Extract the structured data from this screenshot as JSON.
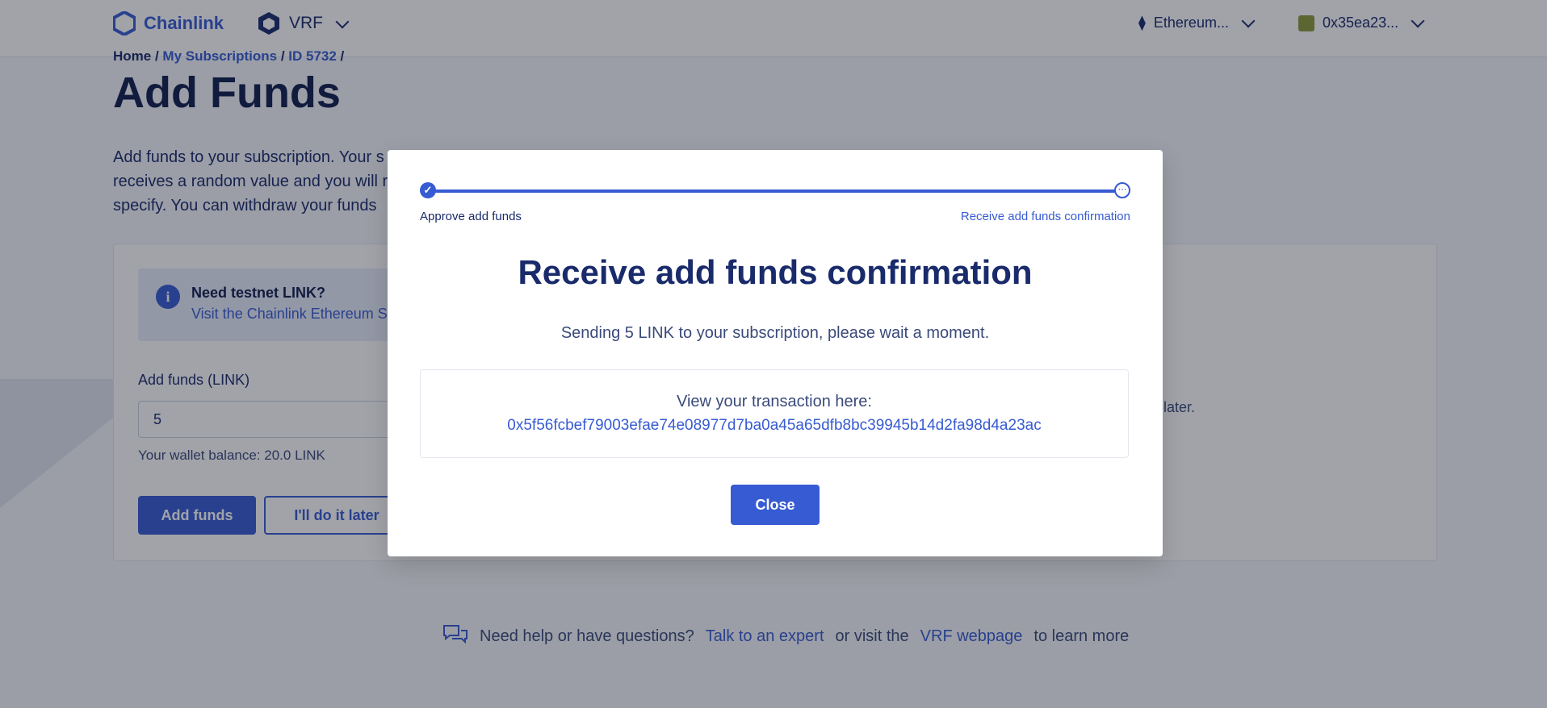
{
  "header": {
    "brand": "Chainlink",
    "product": "VRF",
    "network": "Ethereum...",
    "account": "0x35ea23..."
  },
  "breadcrumb": [
    "Home",
    "My Subscriptions",
    "ID 5732"
  ],
  "page": {
    "title": "Add Funds",
    "intro_lines": [
      "Add funds to your subscription. Your s",
      "receives a random value and you will r",
      "specify. You can withdraw your funds"
    ]
  },
  "notice": {
    "title": "Need testnet LINK?",
    "link": "Visit the Chainlink Ethereum Se"
  },
  "form": {
    "label": "Add funds (LINK)",
    "value": "5",
    "balance": "Your wallet balance: 20.0 LINK",
    "add_button": "Add funds",
    "later_button": "I'll do it later",
    "side_text": "later."
  },
  "help": {
    "text1": "Need help or have questions?",
    "link1": "Talk to an expert",
    "text2": "or visit the",
    "link2": "VRF webpage",
    "text3": "to learn more"
  },
  "modal": {
    "step1": "Approve add funds",
    "step2": "Receive add funds confirmation",
    "title": "Receive add funds confirmation",
    "subtitle": "Sending 5 LINK to your subscription, please wait a moment.",
    "tx_label": "View your transaction here:",
    "tx_hash": "0x5f56fcbef79003efae74e08977d7ba0a45a65dfb8bc39945b14d2fa98d4a23ac",
    "close": "Close"
  },
  "colors": {
    "accent": "#375bd2",
    "navy": "#1a2b6b"
  }
}
